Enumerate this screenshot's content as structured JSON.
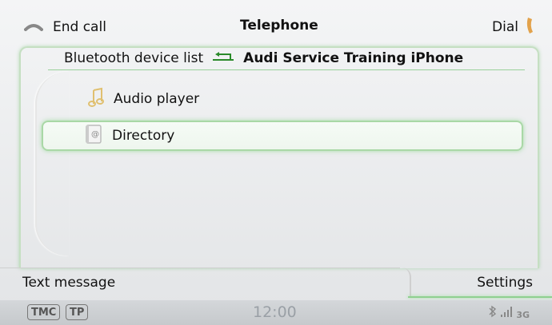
{
  "topbar": {
    "end_call_label": "End call",
    "title": "Telephone",
    "dial_label": "Dial"
  },
  "breadcrumb": {
    "back_label": "Bluetooth device list",
    "device": "Audi Service Training iPhone"
  },
  "list": {
    "items": [
      {
        "label": "Audio player",
        "icon": "music-note-icon"
      },
      {
        "label": "Directory",
        "icon": "address-book-icon",
        "selected": true
      }
    ]
  },
  "bottom_tabs": {
    "left_label": "Text message",
    "right_label": "Settings"
  },
  "statusbar": {
    "tmc": "TMC",
    "tp": "TP",
    "time": "12:00",
    "network": "3G"
  },
  "colors": {
    "accent_green": "#8fd08f",
    "end_call_icon": "#888888",
    "dial_icon": "#e2a24b"
  }
}
